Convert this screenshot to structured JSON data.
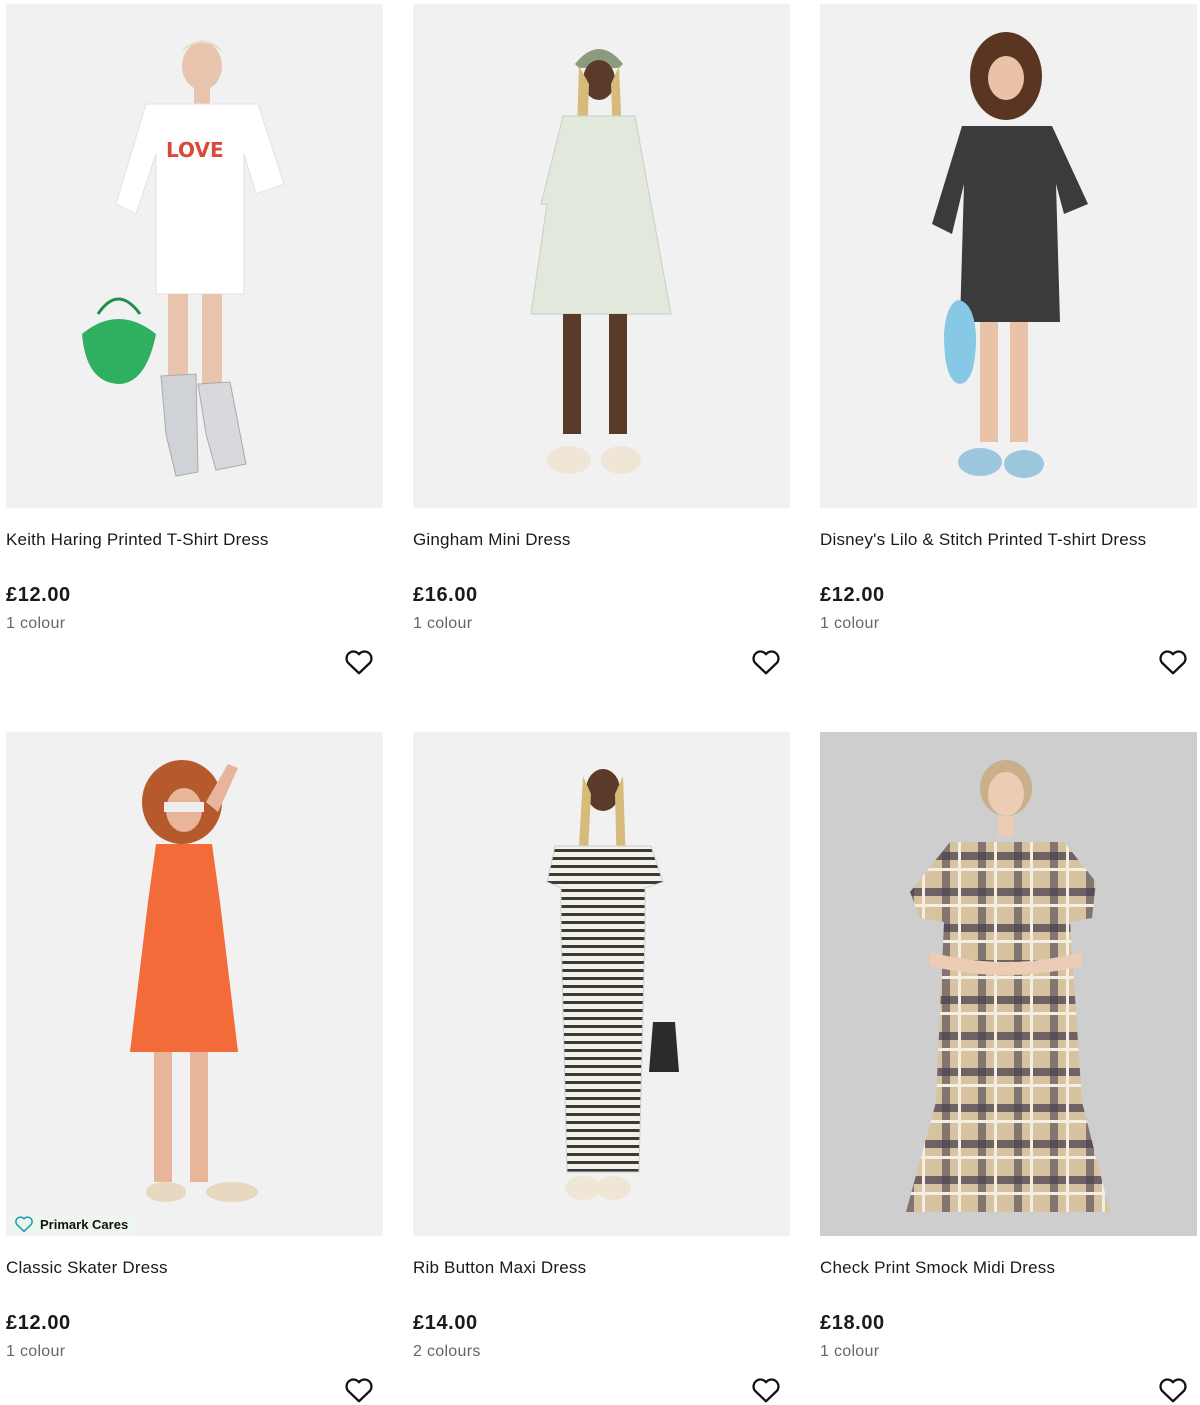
{
  "products": [
    {
      "name": "Keith Haring Printed T-Shirt Dress",
      "price": "£12.00",
      "colours": "1 colour",
      "image_text": "LOVE",
      "badge": ""
    },
    {
      "name": "Gingham Mini Dress",
      "price": "£16.00",
      "colours": "1 colour",
      "badge": ""
    },
    {
      "name": "Disney's Lilo & Stitch Printed T-shirt Dress",
      "price": "£12.00",
      "colours": "1 colour",
      "badge": ""
    },
    {
      "name": "Classic Skater Dress",
      "price": "£12.00",
      "colours": "1 colour",
      "badge": "Primark Cares"
    },
    {
      "name": "Rib Button Maxi Dress",
      "price": "£14.00",
      "colours": "2 colours",
      "badge": ""
    },
    {
      "name": "Check Print Smock Midi Dress",
      "price": "£18.00",
      "colours": "1 colour",
      "badge": ""
    }
  ],
  "icons": {
    "favourite": "heart-outline-icon",
    "badge": "heart-icon"
  },
  "colors": {
    "badge_accent": "#2aa3b3",
    "text": "#1a1a1a",
    "muted": "#666666"
  }
}
